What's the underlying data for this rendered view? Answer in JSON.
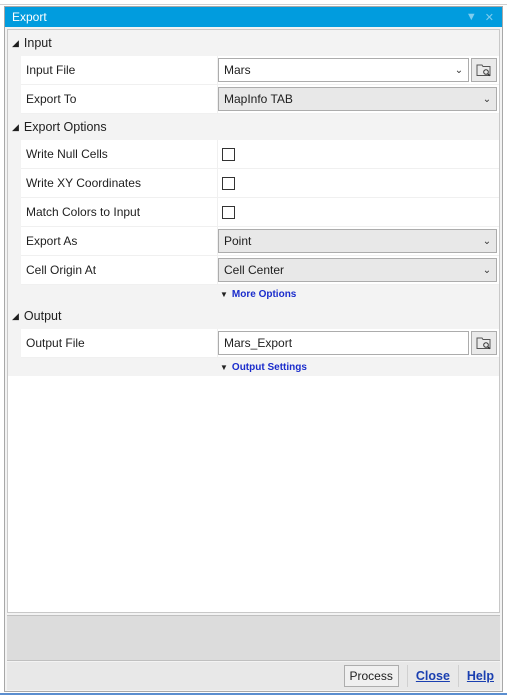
{
  "window": {
    "title": "Export",
    "controls": {
      "menu_icon": "dropdown-arrow",
      "close_icon": "close"
    }
  },
  "sections": {
    "input": {
      "header": "Input",
      "fields": {
        "input_file": {
          "label": "Input File",
          "value": "Mars"
        },
        "export_to": {
          "label": "Export To",
          "value": "MapInfo TAB"
        }
      }
    },
    "export_options": {
      "header": "Export Options",
      "fields": {
        "write_null_cells": {
          "label": "Write Null Cells",
          "checked": false
        },
        "write_xy": {
          "label": "Write XY Coordinates",
          "checked": false
        },
        "match_colors": {
          "label": "Match Colors to Input",
          "checked": false
        },
        "export_as": {
          "label": "Export As",
          "value": "Point"
        },
        "cell_origin": {
          "label": "Cell Origin At",
          "value": "Cell Center"
        }
      },
      "more_options": "More Options"
    },
    "output": {
      "header": "Output",
      "fields": {
        "output_file": {
          "label": "Output File",
          "value": "Mars_Export"
        }
      },
      "output_settings": "Output Settings"
    }
  },
  "buttons": {
    "process": "Process",
    "close": "Close",
    "help": "Help"
  },
  "glyphs": {
    "section_tri": "◢",
    "expand_tri": "▼",
    "chevron": "⌄",
    "close_x": "✕",
    "menu_tri": "▼"
  }
}
